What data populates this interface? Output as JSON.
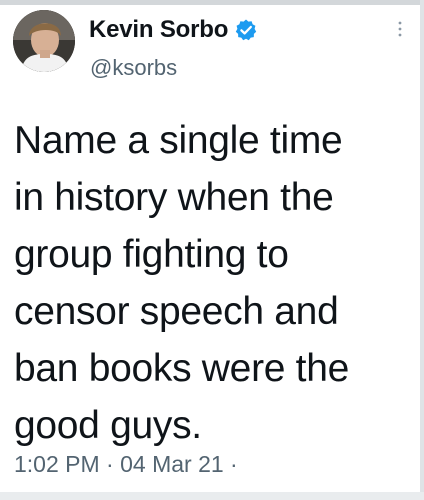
{
  "author": {
    "display_name": "Kevin Sorbo",
    "handle": "@ksorbs",
    "verified": true
  },
  "tweet": {
    "text_lines": [
      "Name a single time",
      "in history when the",
      "group fighting to",
      "censor speech and",
      "ban books were the",
      "good guys."
    ]
  },
  "meta": {
    "timestamp": "1:02 PM · 04 Mar 21 ·"
  },
  "icons": {
    "verified": "verified-badge-icon",
    "more": "more-options-icon"
  },
  "colors": {
    "text": "#0f1419",
    "secondary": "#536471",
    "verified": "#1d9bf0"
  }
}
